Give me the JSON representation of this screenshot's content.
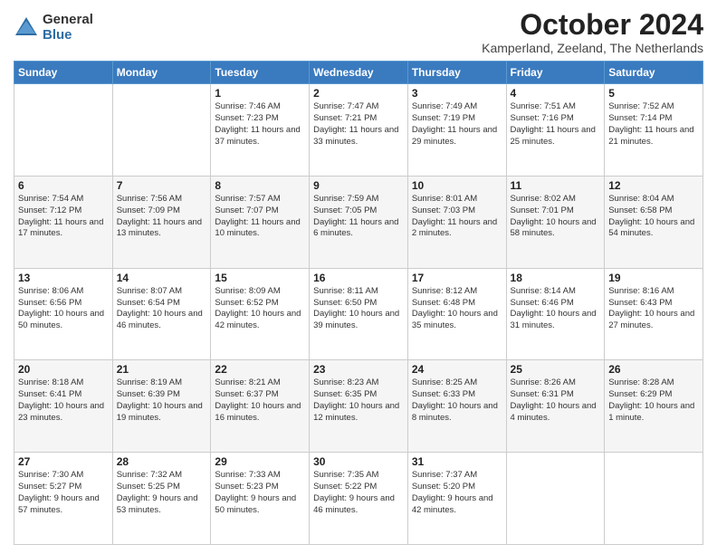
{
  "logo": {
    "general": "General",
    "blue": "Blue"
  },
  "title": "October 2024",
  "subtitle": "Kamperland, Zeeland, The Netherlands",
  "weekdays": [
    "Sunday",
    "Monday",
    "Tuesday",
    "Wednesday",
    "Thursday",
    "Friday",
    "Saturday"
  ],
  "weeks": [
    [
      {
        "day": "",
        "sunrise": "",
        "sunset": "",
        "daylight": ""
      },
      {
        "day": "",
        "sunrise": "",
        "sunset": "",
        "daylight": ""
      },
      {
        "day": "1",
        "sunrise": "Sunrise: 7:46 AM",
        "sunset": "Sunset: 7:23 PM",
        "daylight": "Daylight: 11 hours and 37 minutes."
      },
      {
        "day": "2",
        "sunrise": "Sunrise: 7:47 AM",
        "sunset": "Sunset: 7:21 PM",
        "daylight": "Daylight: 11 hours and 33 minutes."
      },
      {
        "day": "3",
        "sunrise": "Sunrise: 7:49 AM",
        "sunset": "Sunset: 7:19 PM",
        "daylight": "Daylight: 11 hours and 29 minutes."
      },
      {
        "day": "4",
        "sunrise": "Sunrise: 7:51 AM",
        "sunset": "Sunset: 7:16 PM",
        "daylight": "Daylight: 11 hours and 25 minutes."
      },
      {
        "day": "5",
        "sunrise": "Sunrise: 7:52 AM",
        "sunset": "Sunset: 7:14 PM",
        "daylight": "Daylight: 11 hours and 21 minutes."
      }
    ],
    [
      {
        "day": "6",
        "sunrise": "Sunrise: 7:54 AM",
        "sunset": "Sunset: 7:12 PM",
        "daylight": "Daylight: 11 hours and 17 minutes."
      },
      {
        "day": "7",
        "sunrise": "Sunrise: 7:56 AM",
        "sunset": "Sunset: 7:09 PM",
        "daylight": "Daylight: 11 hours and 13 minutes."
      },
      {
        "day": "8",
        "sunrise": "Sunrise: 7:57 AM",
        "sunset": "Sunset: 7:07 PM",
        "daylight": "Daylight: 11 hours and 10 minutes."
      },
      {
        "day": "9",
        "sunrise": "Sunrise: 7:59 AM",
        "sunset": "Sunset: 7:05 PM",
        "daylight": "Daylight: 11 hours and 6 minutes."
      },
      {
        "day": "10",
        "sunrise": "Sunrise: 8:01 AM",
        "sunset": "Sunset: 7:03 PM",
        "daylight": "Daylight: 11 hours and 2 minutes."
      },
      {
        "day": "11",
        "sunrise": "Sunrise: 8:02 AM",
        "sunset": "Sunset: 7:01 PM",
        "daylight": "Daylight: 10 hours and 58 minutes."
      },
      {
        "day": "12",
        "sunrise": "Sunrise: 8:04 AM",
        "sunset": "Sunset: 6:58 PM",
        "daylight": "Daylight: 10 hours and 54 minutes."
      }
    ],
    [
      {
        "day": "13",
        "sunrise": "Sunrise: 8:06 AM",
        "sunset": "Sunset: 6:56 PM",
        "daylight": "Daylight: 10 hours and 50 minutes."
      },
      {
        "day": "14",
        "sunrise": "Sunrise: 8:07 AM",
        "sunset": "Sunset: 6:54 PM",
        "daylight": "Daylight: 10 hours and 46 minutes."
      },
      {
        "day": "15",
        "sunrise": "Sunrise: 8:09 AM",
        "sunset": "Sunset: 6:52 PM",
        "daylight": "Daylight: 10 hours and 42 minutes."
      },
      {
        "day": "16",
        "sunrise": "Sunrise: 8:11 AM",
        "sunset": "Sunset: 6:50 PM",
        "daylight": "Daylight: 10 hours and 39 minutes."
      },
      {
        "day": "17",
        "sunrise": "Sunrise: 8:12 AM",
        "sunset": "Sunset: 6:48 PM",
        "daylight": "Daylight: 10 hours and 35 minutes."
      },
      {
        "day": "18",
        "sunrise": "Sunrise: 8:14 AM",
        "sunset": "Sunset: 6:46 PM",
        "daylight": "Daylight: 10 hours and 31 minutes."
      },
      {
        "day": "19",
        "sunrise": "Sunrise: 8:16 AM",
        "sunset": "Sunset: 6:43 PM",
        "daylight": "Daylight: 10 hours and 27 minutes."
      }
    ],
    [
      {
        "day": "20",
        "sunrise": "Sunrise: 8:18 AM",
        "sunset": "Sunset: 6:41 PM",
        "daylight": "Daylight: 10 hours and 23 minutes."
      },
      {
        "day": "21",
        "sunrise": "Sunrise: 8:19 AM",
        "sunset": "Sunset: 6:39 PM",
        "daylight": "Daylight: 10 hours and 19 minutes."
      },
      {
        "day": "22",
        "sunrise": "Sunrise: 8:21 AM",
        "sunset": "Sunset: 6:37 PM",
        "daylight": "Daylight: 10 hours and 16 minutes."
      },
      {
        "day": "23",
        "sunrise": "Sunrise: 8:23 AM",
        "sunset": "Sunset: 6:35 PM",
        "daylight": "Daylight: 10 hours and 12 minutes."
      },
      {
        "day": "24",
        "sunrise": "Sunrise: 8:25 AM",
        "sunset": "Sunset: 6:33 PM",
        "daylight": "Daylight: 10 hours and 8 minutes."
      },
      {
        "day": "25",
        "sunrise": "Sunrise: 8:26 AM",
        "sunset": "Sunset: 6:31 PM",
        "daylight": "Daylight: 10 hours and 4 minutes."
      },
      {
        "day": "26",
        "sunrise": "Sunrise: 8:28 AM",
        "sunset": "Sunset: 6:29 PM",
        "daylight": "Daylight: 10 hours and 1 minute."
      }
    ],
    [
      {
        "day": "27",
        "sunrise": "Sunrise: 7:30 AM",
        "sunset": "Sunset: 5:27 PM",
        "daylight": "Daylight: 9 hours and 57 minutes."
      },
      {
        "day": "28",
        "sunrise": "Sunrise: 7:32 AM",
        "sunset": "Sunset: 5:25 PM",
        "daylight": "Daylight: 9 hours and 53 minutes."
      },
      {
        "day": "29",
        "sunrise": "Sunrise: 7:33 AM",
        "sunset": "Sunset: 5:23 PM",
        "daylight": "Daylight: 9 hours and 50 minutes."
      },
      {
        "day": "30",
        "sunrise": "Sunrise: 7:35 AM",
        "sunset": "Sunset: 5:22 PM",
        "daylight": "Daylight: 9 hours and 46 minutes."
      },
      {
        "day": "31",
        "sunrise": "Sunrise: 7:37 AM",
        "sunset": "Sunset: 5:20 PM",
        "daylight": "Daylight: 9 hours and 42 minutes."
      },
      {
        "day": "",
        "sunrise": "",
        "sunset": "",
        "daylight": ""
      },
      {
        "day": "",
        "sunrise": "",
        "sunset": "",
        "daylight": ""
      }
    ]
  ]
}
